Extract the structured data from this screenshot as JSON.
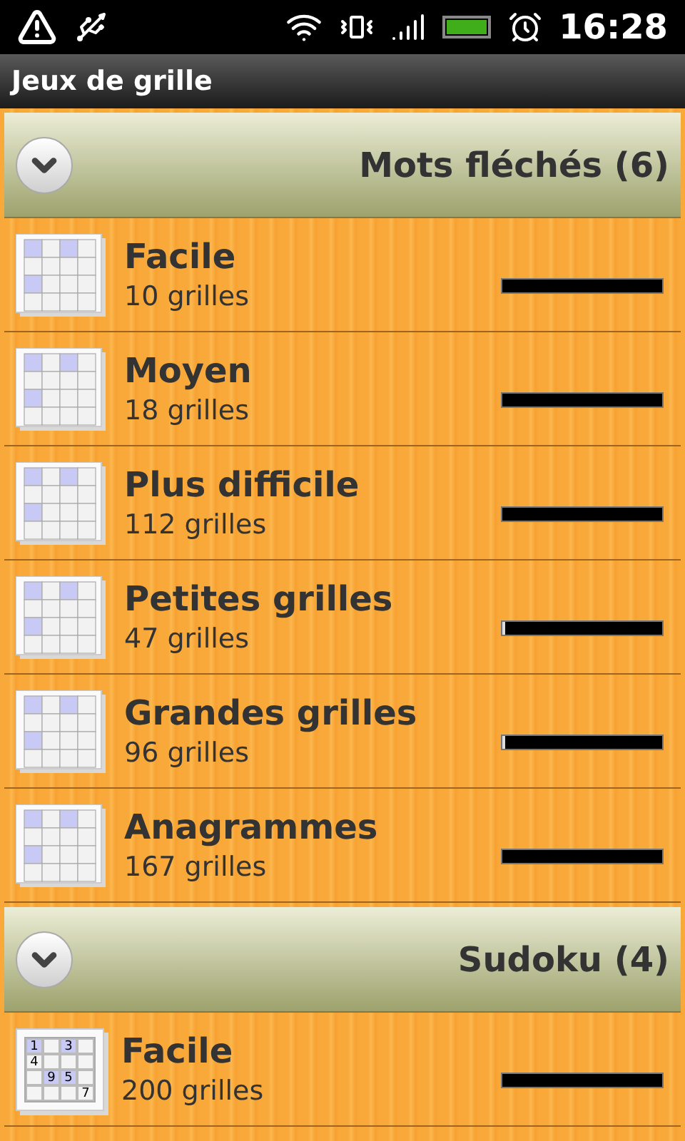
{
  "status_bar": {
    "time": "16:28"
  },
  "title_bar": {
    "title": "Jeux de grille"
  },
  "groups": [
    {
      "title": "Mots fléchés (6)",
      "expanded": true,
      "kind": "arrows",
      "items": [
        {
          "name": "Facile",
          "count": "10 grilles",
          "level": 0
        },
        {
          "name": "Moyen",
          "count": "18 grilles",
          "level": 0
        },
        {
          "name": "Plus difficile",
          "count": "112 grilles",
          "level": 0
        },
        {
          "name": "Petites grilles",
          "count": "47 grilles",
          "level": 0.02
        },
        {
          "name": "Grandes grilles",
          "count": "96 grilles",
          "level": 0.02
        },
        {
          "name": "Anagrammes",
          "count": "167 grilles",
          "level": 0
        }
      ]
    },
    {
      "title": "Sudoku (4)",
      "expanded": true,
      "kind": "sudoku",
      "items": [
        {
          "name": "Facile",
          "count": "200 grilles",
          "level": 0,
          "digits": [
            "1",
            "3",
            "4",
            "9",
            "5",
            "7"
          ]
        }
      ]
    }
  ]
}
